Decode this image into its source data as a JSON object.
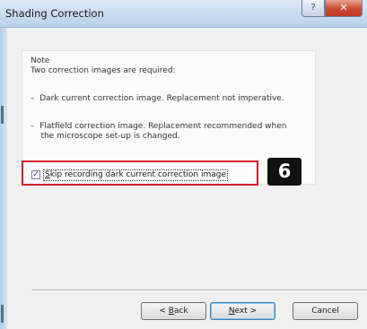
{
  "window": {
    "title": "Shading Correction",
    "help_label": "?",
    "close_label": "✕"
  },
  "note": {
    "label": "Note",
    "intro": "Two correction images are required:",
    "bullets": [
      "–  Dark current correction image. Replacement not imperative.",
      "–  Flatfield correction image. Replacement recommended when\n    the microscope set-up is changed."
    ]
  },
  "skip_option": {
    "checked": true,
    "check_glyph": "✓",
    "label_first": "S",
    "label_rest": "kip recording dark current correction image"
  },
  "callout": {
    "number": "6",
    "color": "#d21f2b"
  },
  "buttons": {
    "back_prefix": "< ",
    "back_key": "B",
    "back_rest": "ack",
    "next_key": "N",
    "next_rest": "ext >",
    "cancel": "Cancel"
  }
}
